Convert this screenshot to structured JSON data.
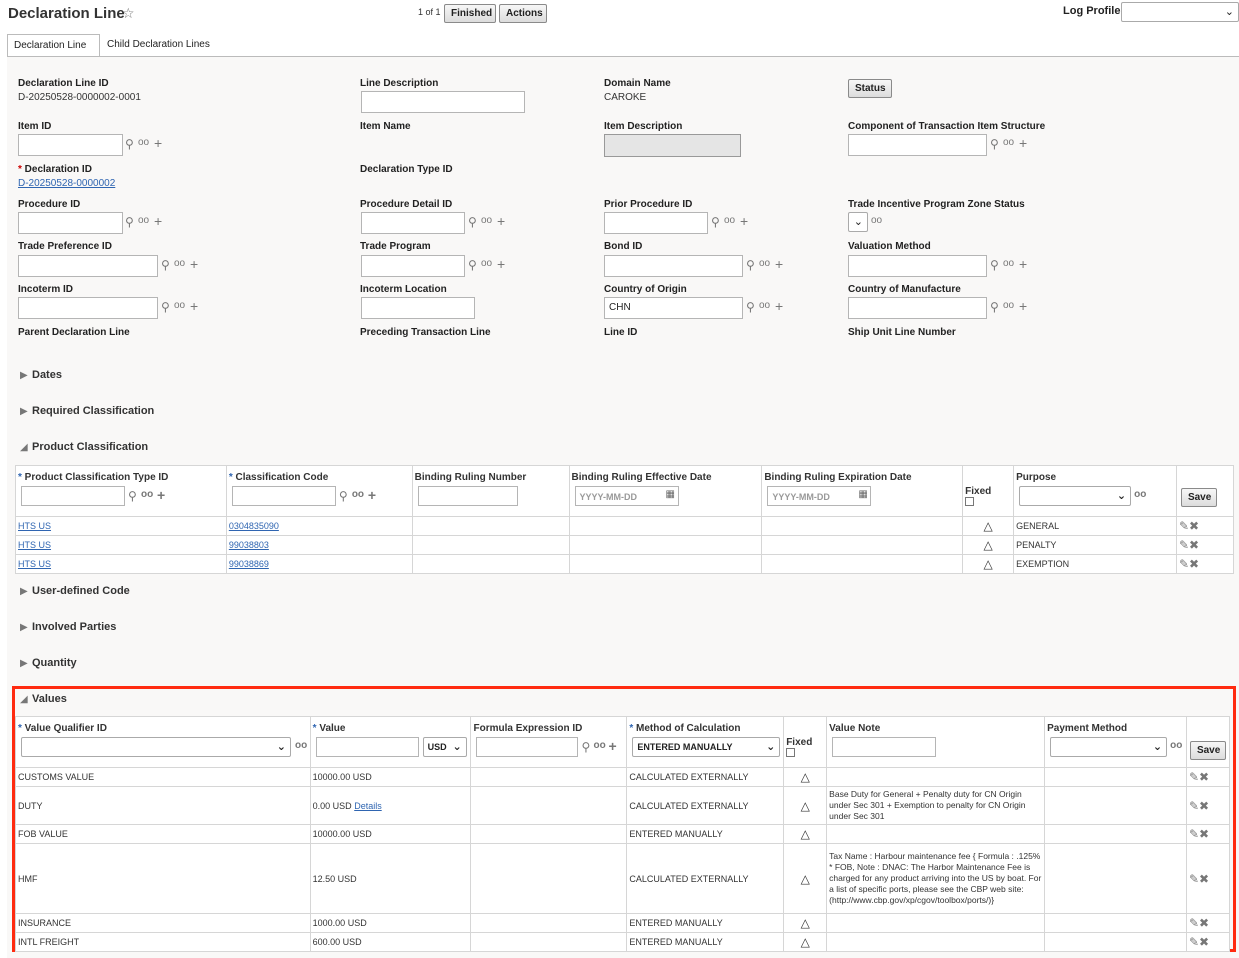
{
  "header": {
    "title": "Declaration Line",
    "pager": "1 of 1",
    "finished_label": "Finished",
    "actions_label": "Actions",
    "log_profile_label": "Log Profile",
    "log_profile_value": ""
  },
  "tabs": [
    "Declaration Line",
    "Child Declaration Lines"
  ],
  "fields": {
    "declaration_line_id_label": "Declaration Line ID",
    "declaration_line_id_value": "D-20250528-0000002-0001",
    "line_description_label": "Line Description",
    "domain_name_label": "Domain Name",
    "domain_name_value": "CAROKE",
    "status_button": "Status",
    "item_id_label": "Item ID",
    "item_name_label": "Item Name",
    "item_description_label": "Item Description",
    "component_label": "Component of Transaction Item Structure",
    "declaration_id_label": "Declaration ID",
    "declaration_id_value": "D-20250528-0000002",
    "declaration_type_label": "Declaration Type ID",
    "procedure_id_label": "Procedure ID",
    "procedure_detail_label": "Procedure Detail ID",
    "prior_procedure_label": "Prior Procedure ID",
    "trade_incentive_label": "Trade Incentive Program Zone Status",
    "trade_preference_label": "Trade Preference ID",
    "trade_program_label": "Trade Program",
    "bond_id_label": "Bond ID",
    "valuation_method_label": "Valuation Method",
    "incoterm_id_label": "Incoterm ID",
    "incoterm_location_label": "Incoterm Location",
    "country_origin_label": "Country of Origin",
    "country_origin_value": "CHN",
    "country_manufacture_label": "Country of Manufacture",
    "parent_decl_label": "Parent Declaration Line",
    "preceding_label": "Preceding Transaction Line",
    "line_id_label": "Line ID",
    "ship_unit_label": "Ship Unit Line Number"
  },
  "sections": {
    "dates": "Dates",
    "required_classification": "Required Classification",
    "product_classification": "Product Classification",
    "user_defined_code": "User-defined Code",
    "involved_parties": "Involved Parties",
    "quantity": "Quantity",
    "values": "Values"
  },
  "product_table": {
    "headers": [
      "Product Classification Type ID",
      "Classification Code",
      "Binding Ruling Number",
      "Binding Ruling Effective Date",
      "Binding Ruling Expiration Date",
      "Fixed",
      "Purpose"
    ],
    "date_placeholder": "YYYY-MM-DD",
    "save_label": "Save",
    "rows": [
      {
        "type": "HTS US",
        "code": "0304835090",
        "purpose": "GENERAL"
      },
      {
        "type": "HTS US",
        "code": "99038803",
        "purpose": "PENALTY"
      },
      {
        "type": "HTS US",
        "code": "99038869",
        "purpose": "EXEMPTION"
      }
    ]
  },
  "values_table": {
    "headers": [
      "Value Qualifier ID",
      "Value",
      "Formula Expression ID",
      "Method of Calculation",
      "Fixed",
      "Value Note",
      "Payment Method"
    ],
    "currency": "USD",
    "method_default": "ENTERED MANUALLY",
    "save_label": "Save",
    "rows": [
      {
        "qualifier": "CUSTOMS VALUE",
        "value": "10000.00 USD",
        "link": "",
        "method": "CALCULATED EXTERNALLY",
        "note": ""
      },
      {
        "qualifier": "DUTY",
        "value": "0.00 USD",
        "link": "Details",
        "method": "CALCULATED EXTERNALLY",
        "note": "Base Duty for General + Penalty duty for CN Origin under Sec 301 + Exemption to penalty for CN Origin under Sec 301"
      },
      {
        "qualifier": "FOB VALUE",
        "value": "10000.00 USD",
        "link": "",
        "method": "ENTERED MANUALLY",
        "note": ""
      },
      {
        "qualifier": "HMF",
        "value": "12.50 USD",
        "link": "",
        "method": "CALCULATED EXTERNALLY",
        "note": "Tax Name : Harbour maintenance fee { Formula : .125% * FOB, Note : DNAC: The Harbor Maintenance Fee is charged for any product arriving into the US by boat. For a list of specific ports, please see the CBP web site: (http://www.cbp.gov/xp/cgov/toolbox/ports/)}"
      },
      {
        "qualifier": "INSURANCE",
        "value": "1000.00 USD",
        "link": "",
        "method": "ENTERED MANUALLY",
        "note": ""
      },
      {
        "qualifier": "INTL FREIGHT",
        "value": "600.00 USD",
        "link": "",
        "method": "ENTERED MANUALLY",
        "note": ""
      }
    ]
  }
}
